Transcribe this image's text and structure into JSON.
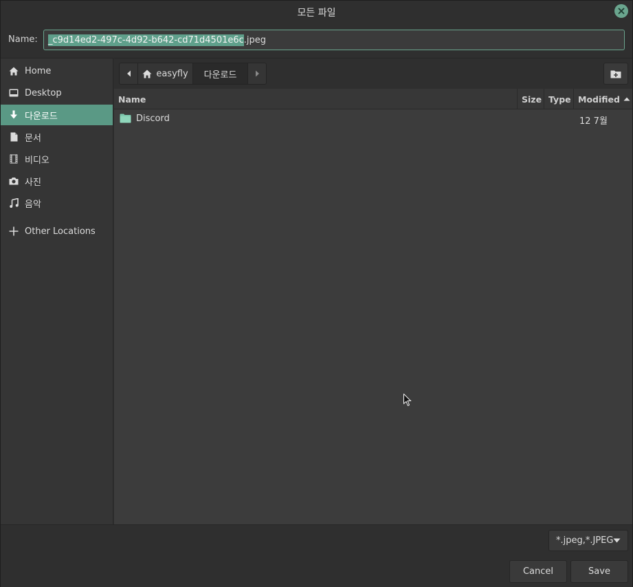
{
  "window": {
    "title": "모든 파일"
  },
  "name_field": {
    "label": "Name:",
    "selected_part": "_c9d14ed2-497c-4d92-b642-cd71d4501e6c",
    "extension_part": ".jpeg"
  },
  "sidebar": {
    "items": [
      {
        "label": "Home",
        "icon": "home-icon",
        "active": false
      },
      {
        "label": "Desktop",
        "icon": "desktop-icon",
        "active": false
      },
      {
        "label": "다운로드",
        "icon": "download-icon",
        "active": true
      },
      {
        "label": "문서",
        "icon": "document-icon",
        "active": false
      },
      {
        "label": "비디오",
        "icon": "video-icon",
        "active": false
      },
      {
        "label": "사진",
        "icon": "camera-icon",
        "active": false
      },
      {
        "label": "음악",
        "icon": "music-icon",
        "active": false
      },
      {
        "label": "Other Locations",
        "icon": "plus-icon",
        "active": false
      }
    ]
  },
  "pathbar": {
    "segments": [
      "easyfly",
      "다운로드"
    ]
  },
  "columns": {
    "name": "Name",
    "size": "Size",
    "type": "Type",
    "modified": "Modified"
  },
  "files": [
    {
      "name": "Discord",
      "kind": "folder",
      "modified": "12  7월"
    }
  ],
  "filter": {
    "selected": "*.jpeg,*.JPEG"
  },
  "buttons": {
    "cancel": "Cancel",
    "save": "Save"
  },
  "colors": {
    "accent": "#5a9985",
    "background": "#2f2f2f",
    "list_bg": "#3c3c3c"
  }
}
